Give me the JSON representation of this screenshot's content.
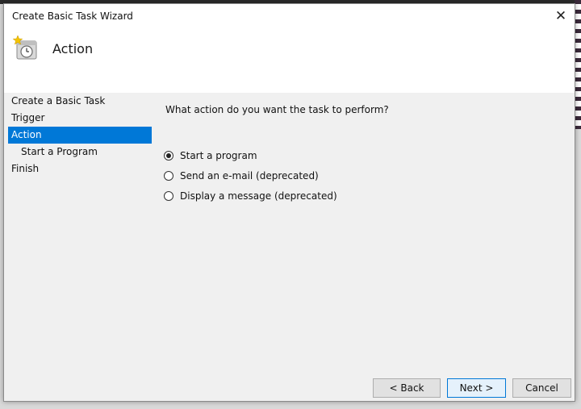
{
  "window": {
    "title": "Create Basic Task Wizard",
    "close_glyph": "✕"
  },
  "header": {
    "title": "Action",
    "icon": "task-scheduler-clock-icon"
  },
  "steps": [
    {
      "label": "Create a Basic Task",
      "active": false,
      "sub": false
    },
    {
      "label": "Trigger",
      "active": false,
      "sub": false
    },
    {
      "label": "Action",
      "active": true,
      "sub": false
    },
    {
      "label": "Start a Program",
      "active": false,
      "sub": true
    },
    {
      "label": "Finish",
      "active": false,
      "sub": false
    }
  ],
  "main": {
    "prompt": "What action do you want the task to perform?",
    "options": [
      {
        "label": "Start a program",
        "selected": true
      },
      {
        "label": "Send an e-mail (deprecated)",
        "selected": false
      },
      {
        "label": "Display a message (deprecated)",
        "selected": false
      }
    ]
  },
  "buttons": {
    "back": "< Back",
    "next": "Next >",
    "cancel": "Cancel"
  },
  "colors": {
    "selection": "#0078d7",
    "dialog_bg": "#f0f0f0"
  }
}
